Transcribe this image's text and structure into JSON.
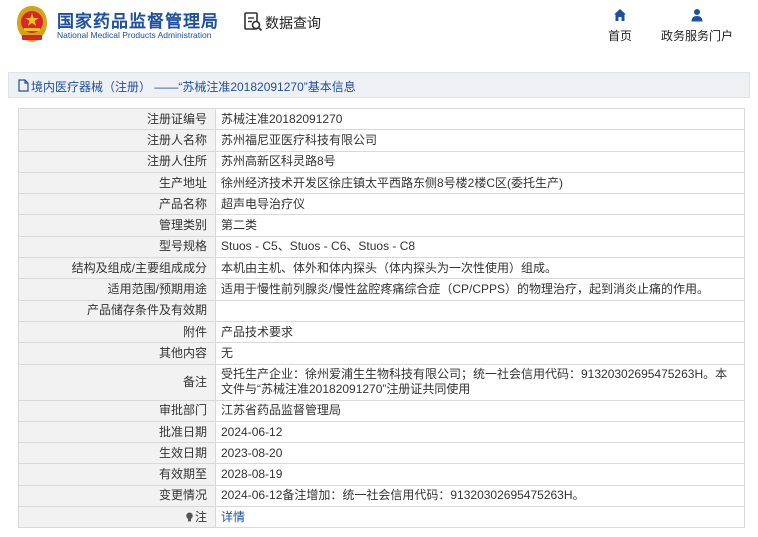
{
  "header": {
    "brand_cn": "国家药品监督管理局",
    "brand_en": "National Medical Products Administration",
    "query_label": "数据查询",
    "nav": [
      {
        "label": "首页",
        "icon": "home-icon"
      },
      {
        "label": "政务服务门户",
        "icon": "user-icon"
      }
    ]
  },
  "breadcrumb": {
    "text": "境内医疗器械（注册） ——“苏械注准20182091270”基本信息"
  },
  "details": {
    "rows": [
      {
        "label": "注册证编号",
        "value": "苏械注准20182091270"
      },
      {
        "label": "注册人名称",
        "value": "苏州福尼亚医疗科技有限公司"
      },
      {
        "label": "注册人住所",
        "value": "苏州高新区科灵路8号"
      },
      {
        "label": "生产地址",
        "value": "徐州经济技术开发区徐庄镇太平西路东侧8号楼2楼C区(委托生产)"
      },
      {
        "label": "产品名称",
        "value": "超声电导治疗仪"
      },
      {
        "label": "管理类别",
        "value": "第二类"
      },
      {
        "label": "型号规格",
        "value": "Stuos - C5、Stuos - C6、Stuos - C8"
      },
      {
        "label": "结构及组成/主要组成成分",
        "value": "本机由主机、体外和体内探头（体内探头为一次性使用）组成。"
      },
      {
        "label": "适用范围/预期用途",
        "value": "适用于慢性前列腺炎/慢性盆腔疼痛综合症（CP/CPPS）的物理治疗，起到消炎止痛的作用。"
      },
      {
        "label": "产品储存条件及有效期",
        "value": ""
      },
      {
        "label": "附件",
        "value": "产品技术要求"
      },
      {
        "label": "其他内容",
        "value": "无"
      },
      {
        "label": "备注",
        "value": "受托生产企业：徐州爱浦生生物科技有限公司；统一社会信用代码：91320302695475263H。本文件与“苏械注准20182091270”注册证共同使用"
      },
      {
        "label": "审批部门",
        "value": "江苏省药品监督管理局"
      },
      {
        "label": "批准日期",
        "value": "2024-06-12"
      },
      {
        "label": "生效日期",
        "value": "2023-08-20"
      },
      {
        "label": "有效期至",
        "value": "2028-08-19"
      },
      {
        "label": "变更情况",
        "value": "2024-06-12备注增加：统一社会信用代码：91320302695475263H。"
      }
    ],
    "note_label": "注",
    "note_link": "详情"
  },
  "colors": {
    "brand_blue": "#1e50a2",
    "label_bg": "#f2f2f2",
    "border": "#d9d9d9"
  }
}
